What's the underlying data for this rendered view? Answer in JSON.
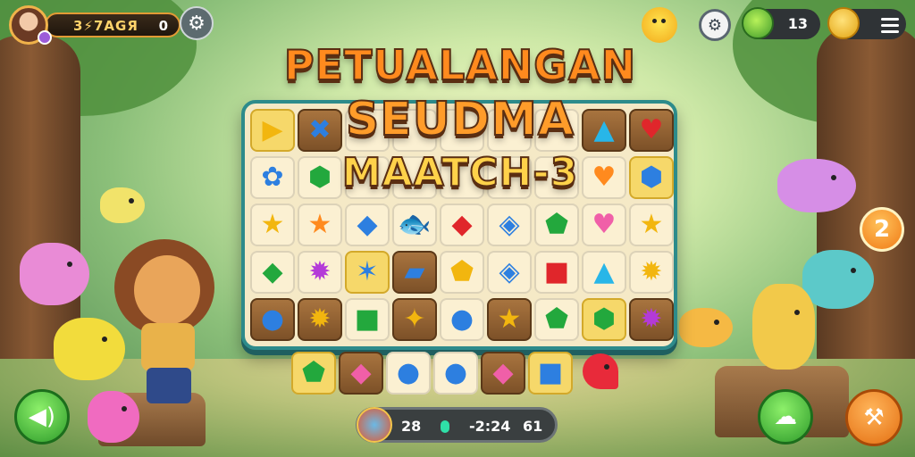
{
  "hud": {
    "profile_name": "3⚡7AGЯ",
    "profile_value": "0",
    "moves": "13",
    "settings_icon": "gear-icon",
    "menu_icon": "menu-icon"
  },
  "title": {
    "line1": "PETUALANGAN",
    "line2": "SEUDMA",
    "line3": "MAATCH-3"
  },
  "board": {
    "rows": [
      [
        {
          "g": "▶",
          "c": "g-yellow",
          "t": "gold"
        },
        {
          "g": "✖",
          "c": "g-blue",
          "t": "wood"
        },
        {
          "g": "",
          "c": "",
          "t": "light"
        },
        {
          "g": "",
          "c": "",
          "t": "light"
        },
        {
          "g": "",
          "c": "",
          "t": "light"
        },
        {
          "g": "",
          "c": "",
          "t": "light"
        },
        {
          "g": "",
          "c": "",
          "t": "light"
        },
        {
          "g": "▲",
          "c": "g-cyan",
          "t": "wood"
        },
        {
          "g": "♥",
          "c": "g-red",
          "t": "wood"
        }
      ],
      [
        {
          "g": "✿",
          "c": "g-blue",
          "t": "light"
        },
        {
          "g": "⬢",
          "c": "g-green",
          "t": "light"
        },
        {
          "g": "",
          "c": "",
          "t": "light"
        },
        {
          "g": "",
          "c": "",
          "t": "light"
        },
        {
          "g": "",
          "c": "",
          "t": "light"
        },
        {
          "g": "",
          "c": "",
          "t": "light"
        },
        {
          "g": "",
          "c": "",
          "t": "light"
        },
        {
          "g": "♥",
          "c": "g-orange",
          "t": "light"
        },
        {
          "g": "⬢",
          "c": "g-blue",
          "t": "gold"
        }
      ],
      [
        {
          "g": "★",
          "c": "g-yellow",
          "t": "light"
        },
        {
          "g": "★",
          "c": "g-orange",
          "t": "light"
        },
        {
          "g": "◆",
          "c": "g-blue",
          "t": "light"
        },
        {
          "g": "🐟",
          "c": "g-orange",
          "t": "light"
        },
        {
          "g": "◆",
          "c": "g-red",
          "t": "light"
        },
        {
          "g": "◈",
          "c": "g-blue",
          "t": "light"
        },
        {
          "g": "⬟",
          "c": "g-green",
          "t": "light"
        },
        {
          "g": "♥",
          "c": "g-pink",
          "t": "light"
        },
        {
          "g": "★",
          "c": "g-yellow",
          "t": "light"
        }
      ],
      [
        {
          "g": "◆",
          "c": "g-green",
          "t": "light"
        },
        {
          "g": "✹",
          "c": "g-purple",
          "t": "light"
        },
        {
          "g": "✶",
          "c": "g-blue",
          "t": "gold"
        },
        {
          "g": "▰",
          "c": "g-blue",
          "t": "wood"
        },
        {
          "g": "⬟",
          "c": "g-yellow",
          "t": "light"
        },
        {
          "g": "◈",
          "c": "g-blue",
          "t": "light"
        },
        {
          "g": "■",
          "c": "g-red",
          "t": "light"
        },
        {
          "g": "▲",
          "c": "g-cyan",
          "t": "light"
        },
        {
          "g": "✹",
          "c": "g-yellow",
          "t": "light"
        }
      ],
      [
        {
          "g": "●",
          "c": "g-blue",
          "t": "wood"
        },
        {
          "g": "✹",
          "c": "g-yellow",
          "t": "wood"
        },
        {
          "g": "■",
          "c": "g-green",
          "t": "light"
        },
        {
          "g": "✦",
          "c": "g-yellow",
          "t": "wood"
        },
        {
          "g": "●",
          "c": "g-blue",
          "t": "light"
        },
        {
          "g": "★",
          "c": "g-yellow",
          "t": "wood"
        },
        {
          "g": "⬟",
          "c": "g-green",
          "t": "light"
        },
        {
          "g": "⬢",
          "c": "g-green",
          "t": "gold"
        },
        {
          "g": "✹",
          "c": "g-purple",
          "t": "wood"
        }
      ]
    ],
    "bottom_row": [
      {
        "g": "⬟",
        "c": "g-green",
        "t": "gold"
      },
      {
        "g": "◆",
        "c": "g-pink",
        "t": "wood"
      },
      {
        "g": "●",
        "c": "g-blue",
        "t": "light"
      },
      {
        "g": "●",
        "c": "g-blue",
        "t": "light"
      },
      {
        "g": "◆",
        "c": "g-pink",
        "t": "wood"
      },
      {
        "g": "■",
        "c": "g-blue",
        "t": "gold"
      }
    ]
  },
  "status": {
    "score": "28",
    "timer": "-2:24",
    "target": "61"
  },
  "level_badge": "2",
  "colors": {
    "board_border": "#2d8b8b",
    "accent_green": "#2d9b2a",
    "accent_orange": "#f07a16"
  }
}
